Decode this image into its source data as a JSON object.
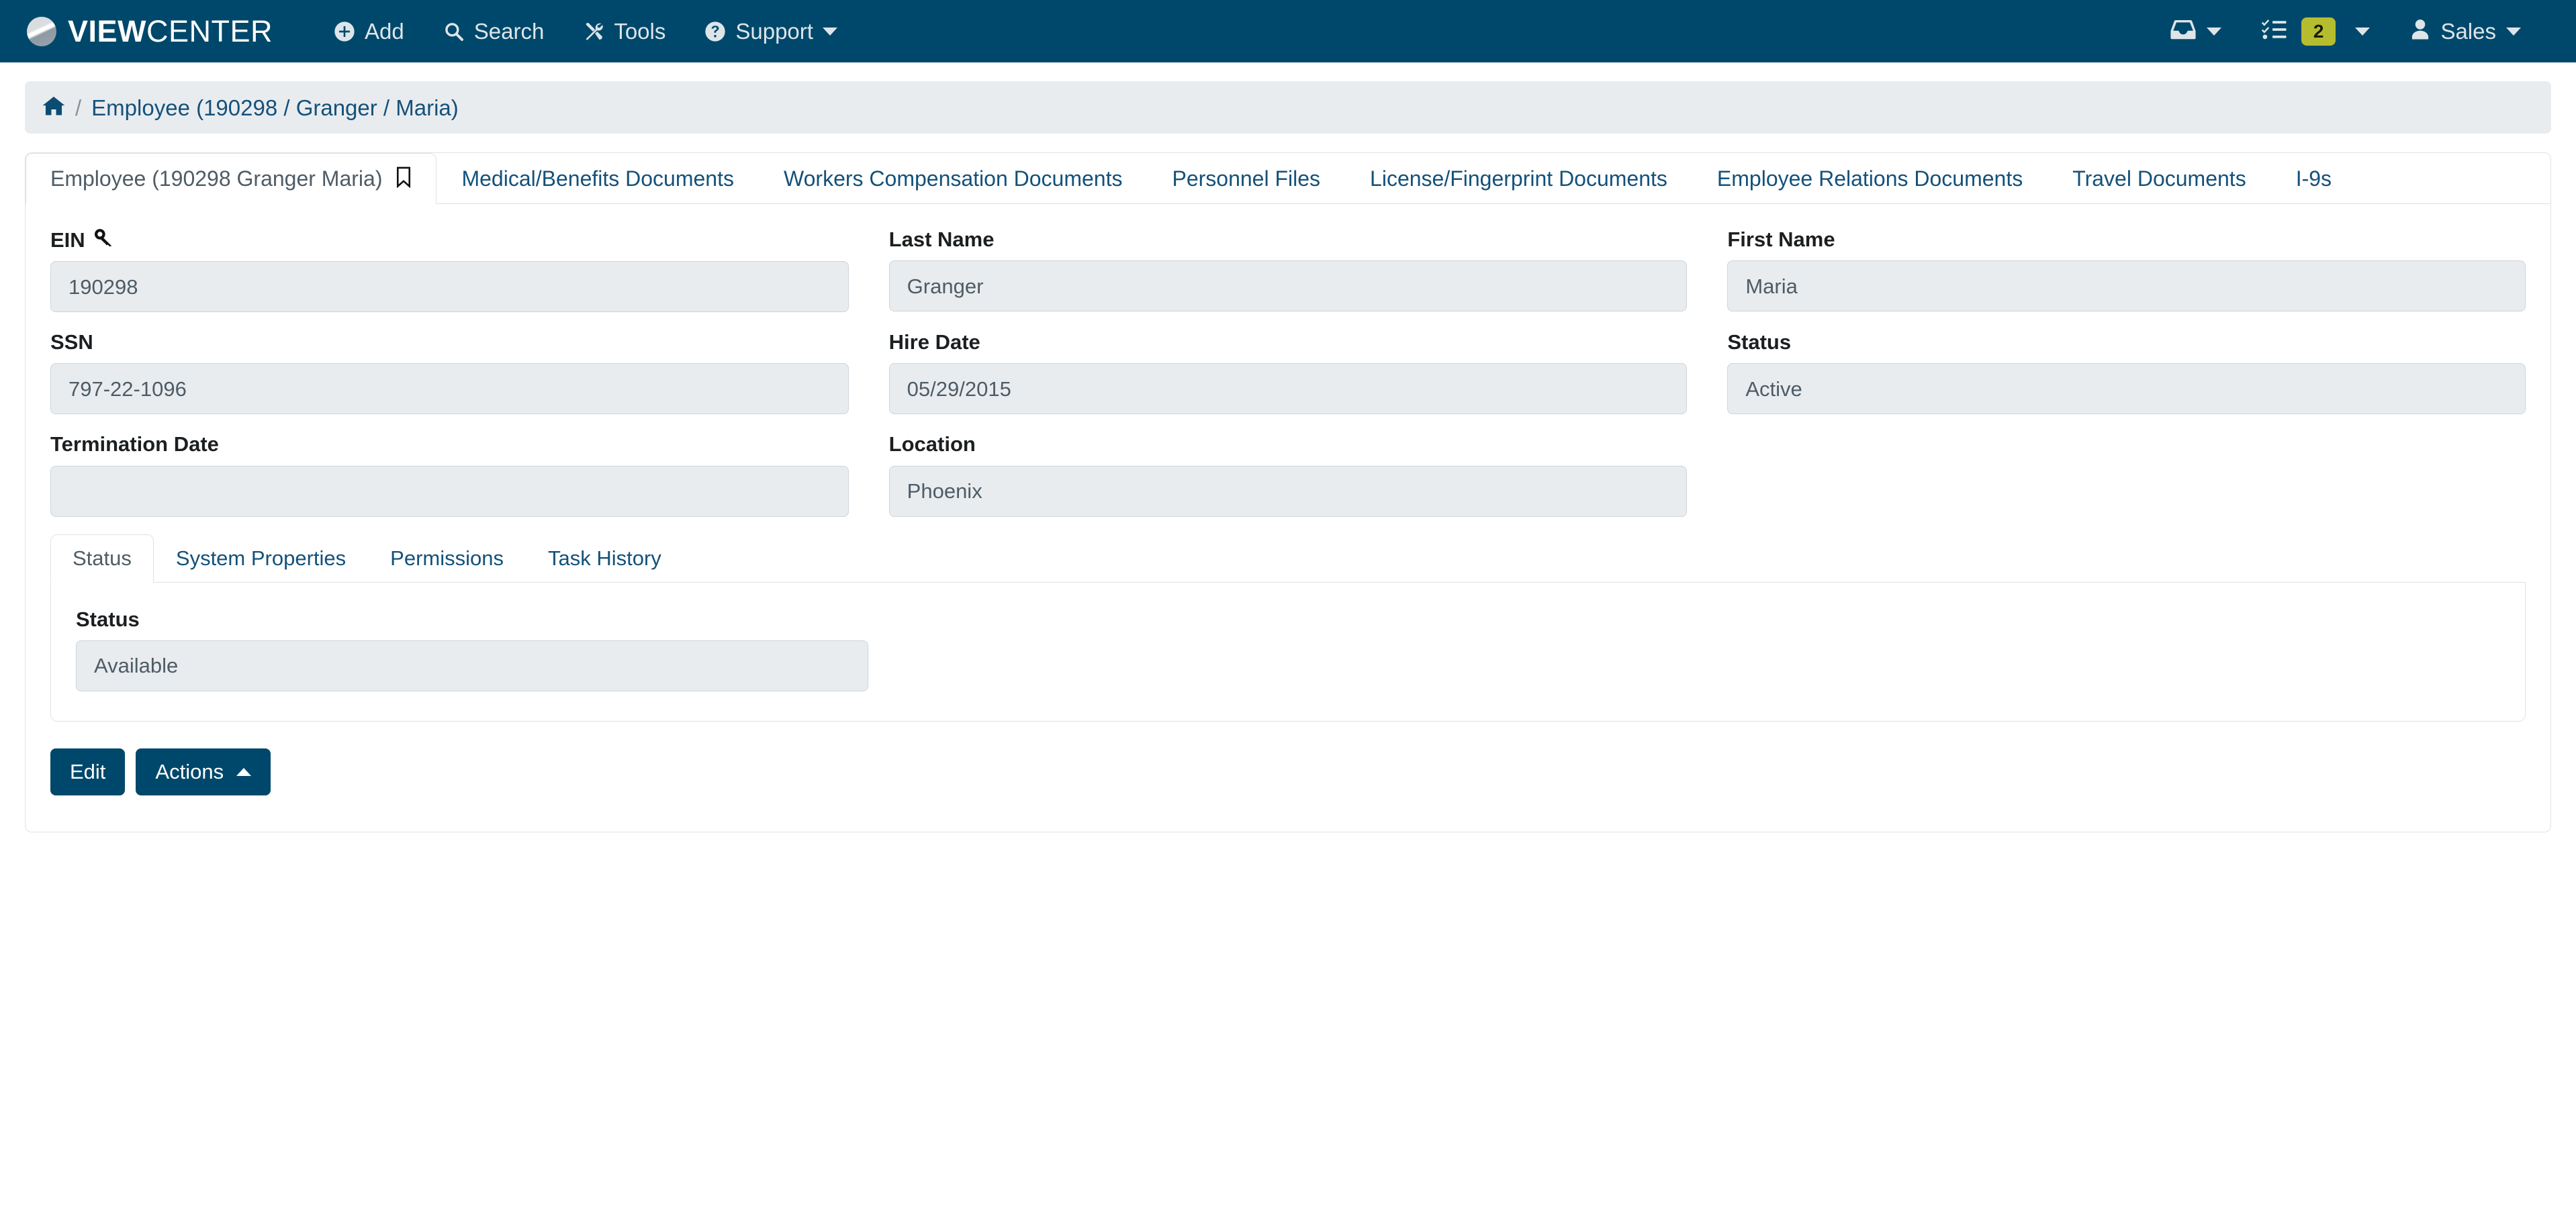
{
  "navbar": {
    "brand_bold": "VIEW",
    "brand_light": "CENTER",
    "logo_icon": "viewcenter-logo-icon",
    "links": [
      {
        "label": "Add",
        "icon": "plus-circle-icon"
      },
      {
        "label": "Search",
        "icon": "search-icon"
      },
      {
        "label": "Tools",
        "icon": "tools-icon"
      },
      {
        "label": "Support",
        "icon": "question-circle-icon",
        "caret": true
      }
    ],
    "right": {
      "inbox_icon": "inbox-icon",
      "tasks_icon": "task-list-icon",
      "tasks_badge": "2",
      "badge_color": "#b5bd2f",
      "user_icon": "user-icon",
      "user_label": "Sales"
    }
  },
  "breadcrumb": {
    "home_icon": "home-icon",
    "separator": "/",
    "current": "Employee (190298 / Granger / Maria)"
  },
  "tabs_top": [
    {
      "label": "Employee (190298 Granger Maria)",
      "active": true,
      "bookmark_icon": "bookmark-icon"
    },
    {
      "label": "Medical/Benefits Documents",
      "active": false
    },
    {
      "label": "Workers Compensation Documents",
      "active": false
    },
    {
      "label": "Personnel Files",
      "active": false
    },
    {
      "label": "License/Fingerprint Documents",
      "active": false
    },
    {
      "label": "Employee Relations Documents",
      "active": false
    },
    {
      "label": "Travel Documents",
      "active": false
    },
    {
      "label": "I-9s",
      "active": false
    }
  ],
  "form": {
    "rows": [
      [
        {
          "label": "EIN",
          "icon": "key-icon",
          "value": "190298"
        },
        {
          "label": "Last Name",
          "value": "Granger"
        },
        {
          "label": "First Name",
          "value": "Maria"
        }
      ],
      [
        {
          "label": "SSN",
          "value": "797-22-1096"
        },
        {
          "label": "Hire Date",
          "value": "05/29/2015"
        },
        {
          "label": "Status",
          "value": "Active"
        }
      ],
      [
        {
          "label": "Termination Date",
          "value": ""
        },
        {
          "label": "Location",
          "value": "Phoenix"
        },
        {
          "label": "",
          "value": "",
          "hidden": true
        }
      ]
    ]
  },
  "inner_tabs": [
    {
      "label": "Status",
      "active": true
    },
    {
      "label": "System Properties",
      "active": false
    },
    {
      "label": "Permissions",
      "active": false
    },
    {
      "label": "Task History",
      "active": false
    }
  ],
  "inner_panel": {
    "field_label": "Status",
    "field_value": "Available"
  },
  "buttons": {
    "edit_label": "Edit",
    "actions_label": "Actions"
  },
  "colors": {
    "navbar_bg": "#00486b",
    "link_blue": "#14517a",
    "field_bg": "#e9ecef",
    "badge": "#b5bd2f",
    "border": "#dee2e6"
  }
}
